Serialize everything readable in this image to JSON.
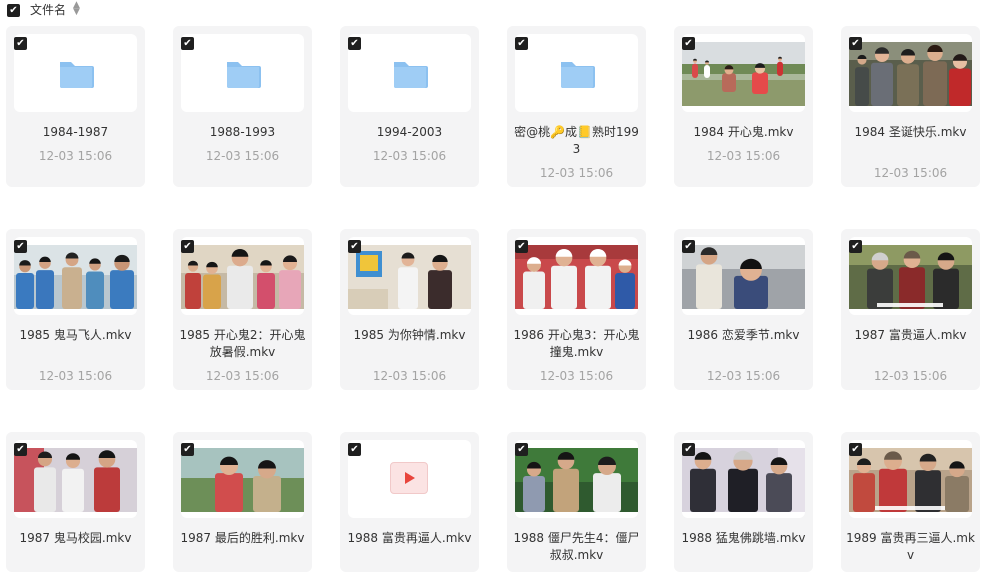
{
  "header": {
    "label": "文件名",
    "checkbox": "✔",
    "sort_glyph": "▲\n▼"
  },
  "files": [
    {
      "name": "1984-1987",
      "time": "12-03 15:06",
      "type": "folder"
    },
    {
      "name": "1988-1993",
      "time": "12-03 15:06",
      "type": "folder"
    },
    {
      "name": "1994-2003",
      "time": "12-03 15:06",
      "type": "folder"
    },
    {
      "name": "密@桃🔑成📒熟时1993",
      "time": "12-03 15:06",
      "type": "folder"
    },
    {
      "name": "1984 开心鬼.mkv",
      "time": "12-03 15:06",
      "type": "video",
      "thumb": "field"
    },
    {
      "name": "1984 圣诞快乐.mkv",
      "time": "12-03 15:06",
      "type": "video",
      "thumb": "group"
    },
    {
      "name": "1985 鬼马飞人.mkv",
      "time": "12-03 15:06",
      "type": "video",
      "thumb": "gym"
    },
    {
      "name": "1985 开心鬼2：开心鬼放暑假.mkv",
      "time": "12-03 15:06",
      "type": "video",
      "thumb": "girls"
    },
    {
      "name": "1985 为你钟情.mkv",
      "time": "12-03 15:06",
      "type": "video",
      "thumb": "room"
    },
    {
      "name": "1986 开心鬼3：开心鬼撞鬼.mkv",
      "time": "12-03 15:06",
      "type": "video",
      "thumb": "band"
    },
    {
      "name": "1986 恋爱季节.mkv",
      "time": "12-03 15:06",
      "type": "video",
      "thumb": "office"
    },
    {
      "name": "1987 富贵逼人.mkv",
      "time": "12-03 15:06",
      "type": "video",
      "thumb": "market"
    },
    {
      "name": "1987 鬼马校园.mkv",
      "time": "",
      "type": "video",
      "thumb": "school"
    },
    {
      "name": "1987 最后的胜利.mkv",
      "time": "",
      "type": "video",
      "thumb": "hill"
    },
    {
      "name": "1988 富贵再逼人.mkv",
      "time": "",
      "type": "video-noimg",
      "thumb": "none"
    },
    {
      "name": "1988 僵尸先生4：僵尸叔叔.mkv",
      "time": "",
      "type": "video",
      "thumb": "forest"
    },
    {
      "name": "1988 猛鬼佛跳墙.mkv",
      "time": "",
      "type": "video",
      "thumb": "suits"
    },
    {
      "name": "1989 富贵再三逼人.mkv",
      "time": "",
      "type": "video",
      "thumb": "family"
    }
  ],
  "colors": {
    "folder": "#8cc1f0",
    "accent_play": "#e8453c",
    "card_bg": "#f4f4f5"
  }
}
